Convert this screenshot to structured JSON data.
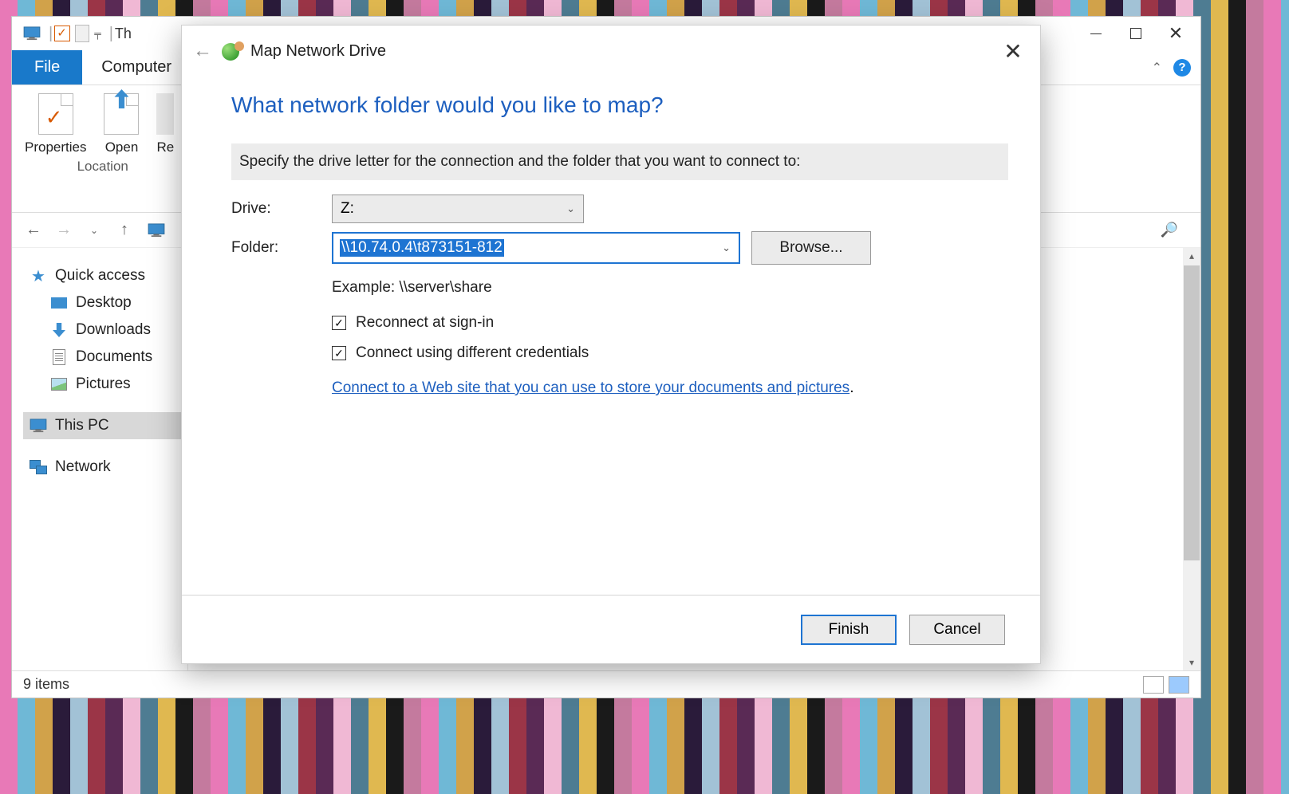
{
  "explorer": {
    "title_fragment": "Th",
    "tabs": {
      "file": "File",
      "computer": "Computer"
    },
    "ribbon": {
      "properties": "Properties",
      "open": "Open",
      "rename_fragment": "Re",
      "group_location": "Location"
    },
    "tree": {
      "quick_access": "Quick access",
      "desktop": "Desktop",
      "downloads": "Downloads",
      "documents": "Documents",
      "pictures": "Pictures",
      "this_pc": "This PC",
      "network": "Network"
    },
    "status": {
      "items": "9 items"
    }
  },
  "dialog": {
    "title": "Map Network Drive",
    "heading": "What network folder would you like to map?",
    "instruction": "Specify the drive letter for the connection and the folder that you want to connect to:",
    "drive_label": "Drive:",
    "drive_value": "Z:",
    "folder_label": "Folder:",
    "folder_value": "\\\\10.74.0.4\\t873151-812",
    "browse": "Browse...",
    "example": "Example: \\\\server\\share",
    "reconnect": "Reconnect at sign-in",
    "diff_creds": "Connect using different credentials",
    "link": "Connect to a Web site that you can use to store your documents and pictures",
    "finish": "Finish",
    "cancel": "Cancel"
  }
}
